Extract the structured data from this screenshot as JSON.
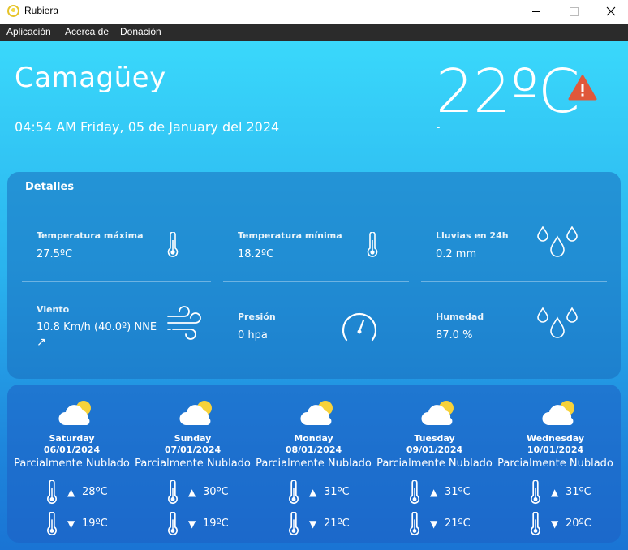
{
  "window": {
    "title": "Rubiera"
  },
  "menu": [
    "Aplicación",
    "Acerca de",
    "Donación"
  ],
  "header": {
    "city": "Camagüey",
    "datetime": "04:54 AM Friday, 05 de January del 2024",
    "temperature": "22ºC",
    "condition": "-",
    "alert_icon": "warning-icon",
    "alert_color": "#e0583a"
  },
  "details": {
    "title": "Detalles",
    "items": [
      {
        "label": "Temperatura máxima",
        "value": "27.5ºC",
        "icon": "thermometer-icon"
      },
      {
        "label": "Temperatura mínima",
        "value": "18.2ºC",
        "icon": "thermometer-icon"
      },
      {
        "label": "Lluvias en 24h",
        "value": "0.2 mm",
        "icon": "raindrops-icon"
      },
      {
        "label": "Viento",
        "value": "10.8 Km/h (40.0º) NNE",
        "icon": "wind-icon",
        "direction_arrow": "↗"
      },
      {
        "label": "Presión",
        "value": "0 hpa",
        "icon": "gauge-icon"
      },
      {
        "label": "Humedad",
        "value": "87.0 %",
        "icon": "raindrops-icon"
      }
    ]
  },
  "forecast": [
    {
      "day": "Saturday",
      "date": "06/01/2024",
      "condition": "Parcialmente Nublado",
      "max": "28ºC",
      "min": "19ºC"
    },
    {
      "day": "Sunday",
      "date": "07/01/2024",
      "condition": "Parcialmente Nublado",
      "max": "30ºC",
      "min": "19ºC"
    },
    {
      "day": "Monday",
      "date": "08/01/2024",
      "condition": "Parcialmente Nublado",
      "max": "31ºC",
      "min": "21ºC"
    },
    {
      "day": "Tuesday",
      "date": "09/01/2024",
      "condition": "Parcialmente Nublado",
      "max": "31ºC",
      "min": "21ºC"
    },
    {
      "day": "Wednesday",
      "date": "10/01/2024",
      "condition": "Parcialmente Nublado",
      "max": "31ºC",
      "min": "20ºC"
    }
  ],
  "symbols": {
    "up": "▲",
    "down": "▼"
  }
}
